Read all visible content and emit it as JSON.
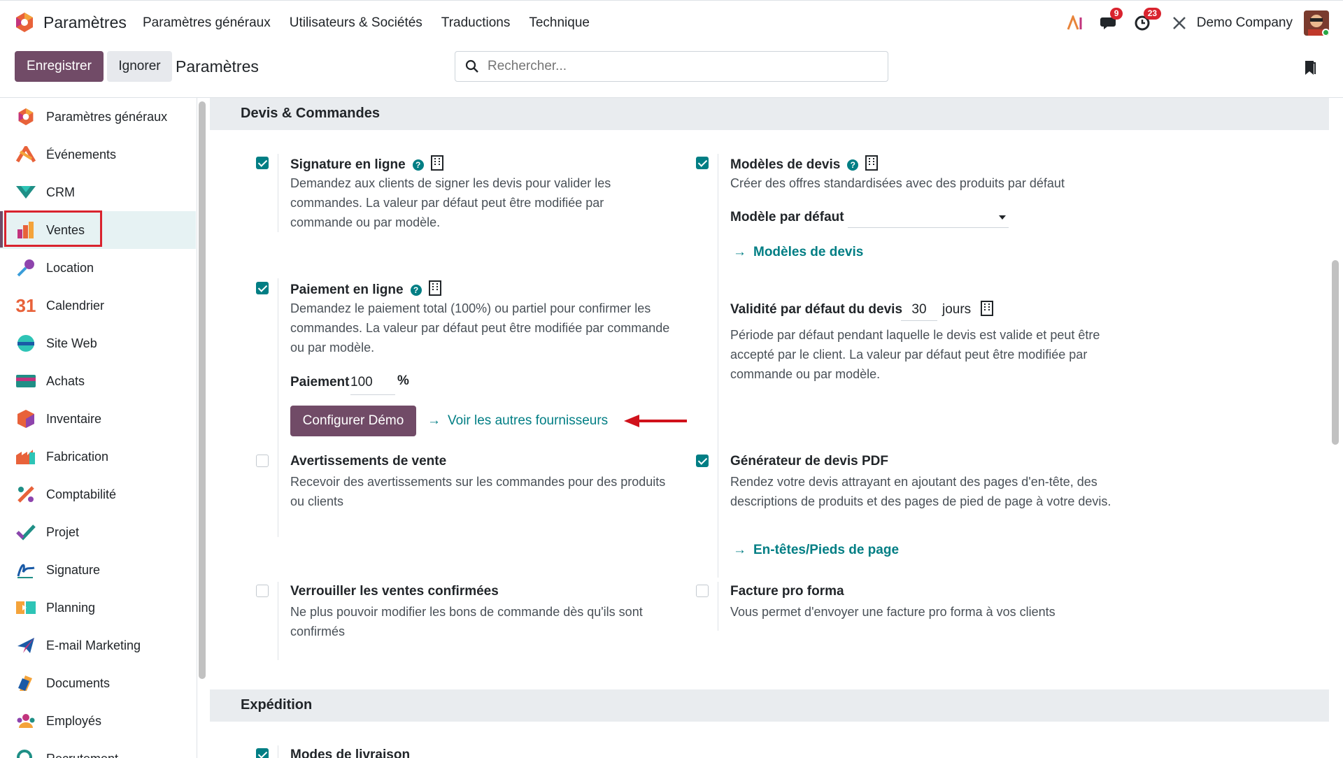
{
  "topbar": {
    "app_title": "Paramètres",
    "menu": [
      "Paramètres généraux",
      "Utilisateurs & Sociétés",
      "Traductions",
      "Technique"
    ],
    "messages_count": "9",
    "activities_count": "23",
    "company": "Demo Company"
  },
  "control": {
    "save_label": "Enregistrer",
    "discard_label": "Ignorer",
    "title": "Paramètres",
    "search_placeholder": "Rechercher..."
  },
  "sidebar": {
    "items": [
      {
        "label": "Paramètres généraux",
        "icon": "odoo-logo-icon"
      },
      {
        "label": "Événements",
        "icon": "events-icon"
      },
      {
        "label": "CRM",
        "icon": "crm-icon"
      },
      {
        "label": "Ventes",
        "icon": "sales-icon"
      },
      {
        "label": "Location",
        "icon": "rental-icon"
      },
      {
        "label": "Calendrier",
        "icon": "calendar-icon"
      },
      {
        "label": "Site Web",
        "icon": "website-icon"
      },
      {
        "label": "Achats",
        "icon": "purchase-icon"
      },
      {
        "label": "Inventaire",
        "icon": "inventory-icon"
      },
      {
        "label": "Fabrication",
        "icon": "manufacturing-icon"
      },
      {
        "label": "Comptabilité",
        "icon": "accounting-icon"
      },
      {
        "label": "Projet",
        "icon": "project-icon"
      },
      {
        "label": "Signature",
        "icon": "sign-icon"
      },
      {
        "label": "Planning",
        "icon": "planning-icon"
      },
      {
        "label": "E-mail Marketing",
        "icon": "email-marketing-icon"
      },
      {
        "label": "Documents",
        "icon": "documents-icon"
      },
      {
        "label": "Employés",
        "icon": "employees-icon"
      },
      {
        "label": "Recrutement",
        "icon": "recruitment-icon"
      }
    ],
    "active": "Ventes"
  },
  "sections": {
    "quotes": {
      "title": "Devis & Commandes",
      "online_signature": {
        "title": "Signature en ligne",
        "checked": true,
        "desc": "Demandez aux clients de signer les devis pour valider les commandes. La valeur par défaut peut être modifiée par commande ou par modèle."
      },
      "quote_templates": {
        "title": "Modèles de devis",
        "checked": true,
        "desc": "Créer des offres standardisées avec des produits par défaut",
        "default_label": "Modèle par défaut",
        "default_value": "",
        "link": "Modèles de devis"
      },
      "online_payment": {
        "title": "Paiement en ligne",
        "checked": true,
        "desc": "Demandez le paiement total (100%) ou partiel pour confirmer les commandes. La valeur par défaut peut être modifiée par commande ou par modèle.",
        "payment_label": "Paiement",
        "payment_value": "100",
        "payment_unit": "%",
        "configure_button": "Configurer Démo",
        "other_providers_link": "Voir les autres fournisseurs"
      },
      "validity": {
        "title": "Validité par défaut du devis",
        "value": "30",
        "unit": "jours",
        "desc": "Période par défaut pendant laquelle le devis est valide et peut être accepté par le client. La valeur par défaut peut être modifiée par commande ou par modèle."
      },
      "sale_warnings": {
        "title": "Avertissements de vente",
        "checked": false,
        "desc": "Recevoir des avertissements sur les commandes pour des produits ou clients"
      },
      "pdf_builder": {
        "title": "Générateur de devis PDF",
        "checked": true,
        "desc": "Rendez votre devis attrayant en ajoutant des pages d'en-tête, des descriptions de produits et des pages de pied de page à votre devis.",
        "link": "En-têtes/Pieds de page"
      },
      "lock_confirmed": {
        "title": "Verrouiller les ventes confirmées",
        "checked": false,
        "desc": "Ne plus pouvoir modifier les bons de commande dès qu'ils sont confirmés"
      },
      "proforma": {
        "title": "Facture pro forma",
        "checked": false,
        "desc": "Vous permet d'envoyer une facture pro forma à vos clients"
      }
    },
    "shipping": {
      "title": "Expédition",
      "delivery_methods": {
        "title": "Modes de livraison",
        "checked": true
      }
    }
  }
}
